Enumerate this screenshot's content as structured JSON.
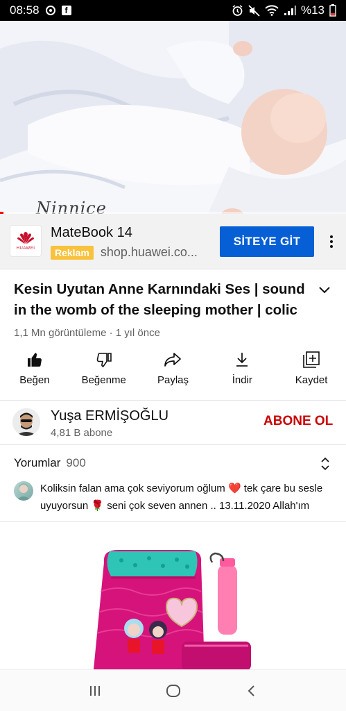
{
  "status_bar": {
    "time": "08:58",
    "battery": "%13",
    "left_icons": [
      "sync-icon",
      "facebook-icon"
    ],
    "right_icons": [
      "alarm-icon",
      "mute-icon",
      "wifi-icon",
      "signal-icon",
      "battery-icon"
    ]
  },
  "video": {
    "overlay_text": "Ninnice",
    "progress_fraction": 0.01
  },
  "ad": {
    "brand_logo_text": "HUAWEI",
    "title": "MateBook 14",
    "badge": "Reklam",
    "domain": "shop.huawei.co...",
    "cta_label": "SİTEYE GİT"
  },
  "video_info": {
    "title": "Kesin Uyutan Anne Karnındaki Ses | sound in the womb of the sleeping mother | colic",
    "meta": "1,1 Mn görüntüleme · 1 yıl önce"
  },
  "actions": [
    {
      "label": "Beğen",
      "icon": "thumbs-up-icon"
    },
    {
      "label": "Beğenme",
      "icon": "thumbs-down-icon"
    },
    {
      "label": "Paylaş",
      "icon": "share-icon"
    },
    {
      "label": "İndir",
      "icon": "download-icon"
    },
    {
      "label": "Kaydet",
      "icon": "save-playlist-icon"
    }
  ],
  "channel": {
    "name": "Yuşa ERMİŞOĞLU",
    "subscribers": "4,81 B abone",
    "subscribe_label": "ABONE OL"
  },
  "comments": {
    "label": "Yorumlar",
    "count": "900",
    "top_comment": "Koliksin falan ama çok seviyorum oğlum ❤️ tek çare bu sesle uyuyorsun 🌹 seni çok seven annen .. 13.11.2020 Allah'ım"
  },
  "colors": {
    "accent_blue": "#065fd4",
    "subscribe_red": "#cc0000",
    "ad_badge": "#f9c23c",
    "product_pink": "#e3127d"
  }
}
